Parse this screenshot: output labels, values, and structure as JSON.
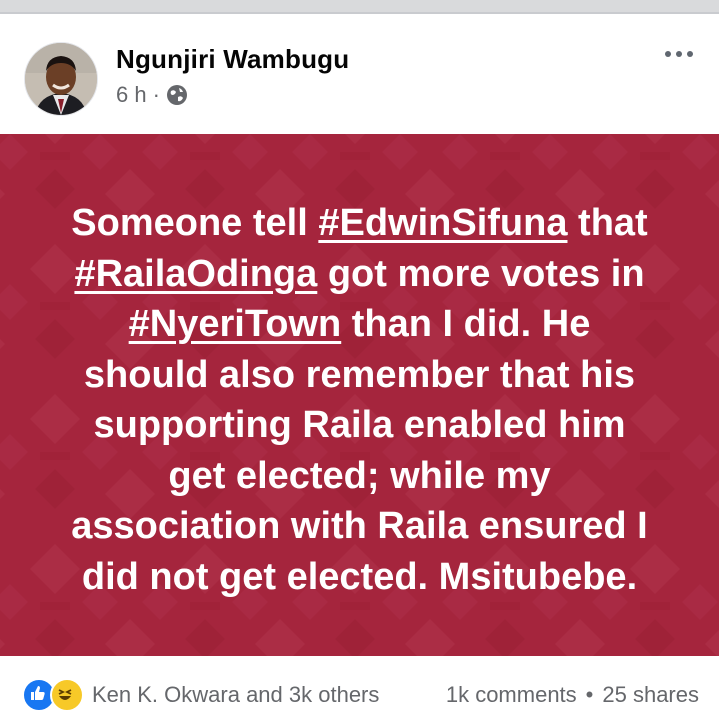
{
  "post": {
    "author": "Ngunjiri Wambugu",
    "time": "6 h",
    "separator": "·",
    "audience_icon": "globe-icon",
    "background_color": "#a5253d",
    "text_lines": [
      [
        "Someone tell ",
        "#EdwinSifuna",
        " that"
      ],
      [
        "#RailaOdinga",
        " got more votes in"
      ],
      [
        "#NyeriTown",
        " than I did. He"
      ],
      [
        "should also remember that his"
      ],
      [
        "supporting Raila enabled him"
      ],
      [
        "get elected; while my"
      ],
      [
        "association with Raila ensured I"
      ],
      [
        "did not get elected. Msitubebe."
      ]
    ]
  },
  "engagement": {
    "reactions_text": "Ken K. Okwara and 3k others",
    "comments": "1k comments",
    "dot": "•",
    "shares": "25 shares",
    "reaction_icons": [
      "like-icon",
      "haha-icon"
    ]
  }
}
